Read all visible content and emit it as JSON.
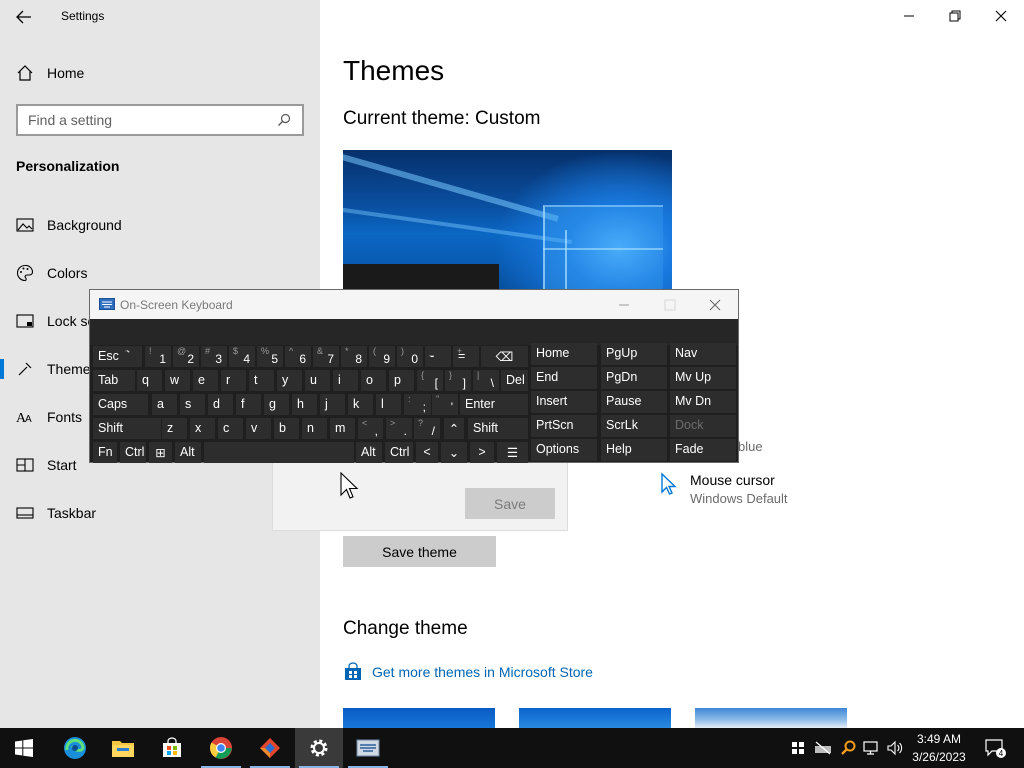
{
  "settings": {
    "app_title": "Settings",
    "nav_home": "Home",
    "search_placeholder": "Find a setting",
    "section_title": "Personalization",
    "nav_items": [
      {
        "label": "Background",
        "icon": "picture-icon"
      },
      {
        "label": "Colors",
        "icon": "palette-icon"
      },
      {
        "label": "Lock screen",
        "icon": "lock-screen-icon"
      },
      {
        "label": "Themes",
        "icon": "themes-icon"
      },
      {
        "label": "Fonts",
        "icon": "fonts-icon"
      },
      {
        "label": "Start",
        "icon": "start-icon"
      },
      {
        "label": "Taskbar",
        "icon": "taskbar-icon"
      }
    ],
    "active_nav": "Themes"
  },
  "main": {
    "title": "Themes",
    "current_theme": "Current theme: Custom",
    "color_partial": "blue",
    "mouse_cursor": {
      "label": "Mouse cursor",
      "value": "Windows Default"
    },
    "dialog_save": "Save",
    "save_theme": "Save theme",
    "change_theme": "Change theme",
    "store_link": "Get more themes in Microsoft Store"
  },
  "osk": {
    "title": "On-Screen Keyboard",
    "row1": [
      {
        "m": "Esc"
      },
      {
        "s": "~",
        "m": "`"
      },
      {
        "s": "!",
        "b": "1"
      },
      {
        "s": "@",
        "b": "2"
      },
      {
        "s": "#",
        "b": "3"
      },
      {
        "s": "$",
        "b": "4"
      },
      {
        "s": "%",
        "b": "5"
      },
      {
        "s": "^",
        "b": "6"
      },
      {
        "s": "&",
        "b": "7"
      },
      {
        "s": "*",
        "b": "8"
      },
      {
        "s": "(",
        "b": "9"
      },
      {
        "s": ")",
        "b": "0"
      },
      {
        "s": "_",
        "m": "-"
      },
      {
        "s": "+",
        "m": "="
      },
      {
        "m": "⌫"
      }
    ],
    "row2": [
      {
        "m": "Tab"
      },
      {
        "m": "q"
      },
      {
        "m": "w"
      },
      {
        "m": "e"
      },
      {
        "m": "r"
      },
      {
        "m": "t"
      },
      {
        "m": "y"
      },
      {
        "m": "u"
      },
      {
        "m": "i"
      },
      {
        "m": "o"
      },
      {
        "m": "p"
      },
      {
        "s": "{",
        "b": "["
      },
      {
        "s": "}",
        "b": "]"
      },
      {
        "s": "|",
        "b": "\\"
      },
      {
        "m": "Del"
      }
    ],
    "row3": [
      {
        "m": "Caps"
      },
      {
        "m": "a"
      },
      {
        "m": "s"
      },
      {
        "m": "d"
      },
      {
        "m": "f"
      },
      {
        "m": "g"
      },
      {
        "m": "h"
      },
      {
        "m": "j"
      },
      {
        "m": "k"
      },
      {
        "m": "l"
      },
      {
        "s": ":",
        "b": ";"
      },
      {
        "s": "\"",
        "b": "'"
      },
      {
        "m": "Enter"
      }
    ],
    "row4": [
      {
        "m": "Shift"
      },
      {
        "m": "z"
      },
      {
        "m": "x"
      },
      {
        "m": "c"
      },
      {
        "m": "v"
      },
      {
        "m": "b"
      },
      {
        "m": "n"
      },
      {
        "m": "m"
      },
      {
        "s": "<",
        "b": ","
      },
      {
        "s": ">",
        "b": "."
      },
      {
        "s": "?",
        "b": "/"
      },
      {
        "m": "⌃"
      },
      {
        "m": "Shift"
      }
    ],
    "row5": [
      {
        "m": "Fn"
      },
      {
        "m": "Ctrl"
      },
      {
        "m": "⊞"
      },
      {
        "m": "Alt"
      },
      {
        "m": ""
      },
      {
        "m": "Alt"
      },
      {
        "m": "Ctrl"
      },
      {
        "m": "<"
      },
      {
        "m": "⌄"
      },
      {
        "m": ">"
      },
      {
        "m": "☰"
      }
    ],
    "nav_block": [
      [
        "Home",
        "PgUp",
        "Nav"
      ],
      [
        "End",
        "PgDn",
        "Mv Up"
      ],
      [
        "Insert",
        "Pause",
        "Mv Dn"
      ],
      [
        "PrtScn",
        "ScrLk",
        "Dock"
      ],
      [
        "Options",
        "Help",
        "Fade"
      ]
    ]
  },
  "taskbar": {
    "apps": [
      "start-icon",
      "edge-icon",
      "file-explorer-icon",
      "store-icon",
      "chrome-icon",
      "app-icon",
      "settings-icon",
      "on-screen-keyboard-icon"
    ],
    "active_app": "settings-icon",
    "time": "3:49 AM",
    "date": "3/26/2023",
    "notification_count": "4"
  },
  "colors": {
    "accent": "#0078d7",
    "sidebar_bg": "#e6e6e6",
    "link": "#0066b4",
    "osk_bg": "#1f1f1f",
    "osk_key": "#2d2d2d",
    "taskbar_bg": "#101010"
  }
}
